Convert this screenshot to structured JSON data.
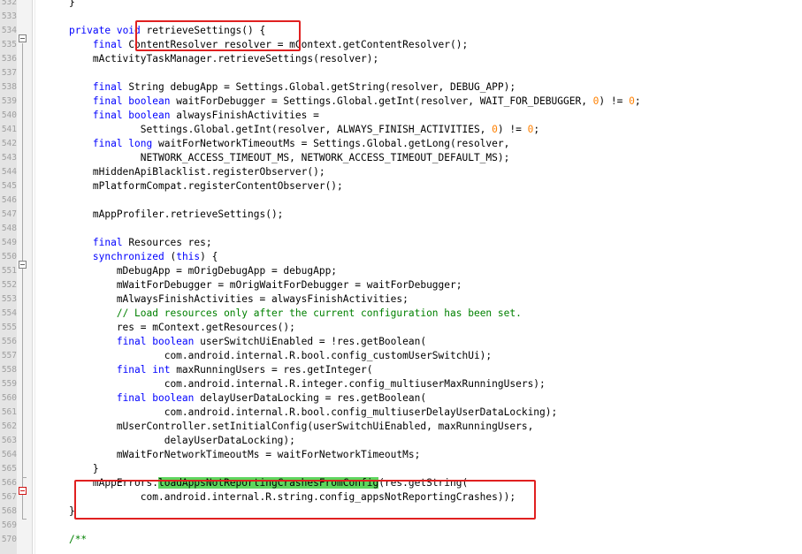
{
  "editor": {
    "lines": [
      {
        "n": "532",
        "t": [
          {
            "s": "    }"
          }
        ]
      },
      {
        "n": "533",
        "t": [
          {
            "s": ""
          }
        ]
      },
      {
        "n": "534",
        "t": [
          {
            "s": "    "
          },
          {
            "s": "private void",
            "c": "kw"
          },
          {
            "s": " retrieveSettings() {"
          }
        ]
      },
      {
        "n": "535",
        "t": [
          {
            "s": "        "
          },
          {
            "s": "final",
            "c": "kw"
          },
          {
            "s": " ContentResolver resolver = mContext.getContentResolver();"
          }
        ]
      },
      {
        "n": "536",
        "t": [
          {
            "s": "        mActivityTaskManager.retrieveSettings(resolver);"
          }
        ]
      },
      {
        "n": "537",
        "t": [
          {
            "s": ""
          }
        ]
      },
      {
        "n": "538",
        "t": [
          {
            "s": "        "
          },
          {
            "s": "final",
            "c": "kw"
          },
          {
            "s": " String debugApp = Settings.Global.getString(resolver, DEBUG_APP);"
          }
        ]
      },
      {
        "n": "539",
        "t": [
          {
            "s": "        "
          },
          {
            "s": "final boolean",
            "c": "kw"
          },
          {
            "s": " waitForDebugger = Settings.Global.getInt(resolver, WAIT_FOR_DEBUGGER, "
          },
          {
            "s": "0",
            "c": "num"
          },
          {
            "s": ") != "
          },
          {
            "s": "0",
            "c": "num"
          },
          {
            "s": ";"
          }
        ]
      },
      {
        "n": "540",
        "t": [
          {
            "s": "        "
          },
          {
            "s": "final boolean",
            "c": "kw"
          },
          {
            "s": " alwaysFinishActivities ="
          }
        ]
      },
      {
        "n": "541",
        "t": [
          {
            "s": "                Settings.Global.getInt(resolver, ALWAYS_FINISH_ACTIVITIES, "
          },
          {
            "s": "0",
            "c": "num"
          },
          {
            "s": ") != "
          },
          {
            "s": "0",
            "c": "num"
          },
          {
            "s": ";"
          }
        ]
      },
      {
        "n": "542",
        "t": [
          {
            "s": "        "
          },
          {
            "s": "final long",
            "c": "kw"
          },
          {
            "s": " waitForNetworkTimeoutMs = Settings.Global.getLong(resolver,"
          }
        ]
      },
      {
        "n": "543",
        "t": [
          {
            "s": "                NETWORK_ACCESS_TIMEOUT_MS, NETWORK_ACCESS_TIMEOUT_DEFAULT_MS);"
          }
        ]
      },
      {
        "n": "544",
        "t": [
          {
            "s": "        mHiddenApiBlacklist.registerObserver();"
          }
        ]
      },
      {
        "n": "545",
        "t": [
          {
            "s": "        mPlatformCompat.registerContentObserver();"
          }
        ]
      },
      {
        "n": "546",
        "t": [
          {
            "s": ""
          }
        ]
      },
      {
        "n": "547",
        "t": [
          {
            "s": "        mAppProfiler.retrieveSettings();"
          }
        ]
      },
      {
        "n": "548",
        "t": [
          {
            "s": ""
          }
        ]
      },
      {
        "n": "549",
        "t": [
          {
            "s": "        "
          },
          {
            "s": "final",
            "c": "kw"
          },
          {
            "s": " Resources res;"
          }
        ]
      },
      {
        "n": "550",
        "t": [
          {
            "s": "        "
          },
          {
            "s": "synchronized",
            "c": "kw"
          },
          {
            "s": " ("
          },
          {
            "s": "this",
            "c": "kw"
          },
          {
            "s": ") {"
          }
        ]
      },
      {
        "n": "551",
        "t": [
          {
            "s": "            mDebugApp = mOrigDebugApp = debugApp;"
          }
        ]
      },
      {
        "n": "552",
        "t": [
          {
            "s": "            mWaitForDebugger = mOrigWaitForDebugger = waitForDebugger;"
          }
        ]
      },
      {
        "n": "553",
        "t": [
          {
            "s": "            mAlwaysFinishActivities = alwaysFinishActivities;"
          }
        ]
      },
      {
        "n": "554",
        "t": [
          {
            "s": "            "
          },
          {
            "s": "// Load resources only after the current configuration has been set.",
            "c": "cm"
          }
        ]
      },
      {
        "n": "555",
        "t": [
          {
            "s": "            res = mContext.getResources();"
          }
        ]
      },
      {
        "n": "556",
        "t": [
          {
            "s": "            "
          },
          {
            "s": "final boolean",
            "c": "kw"
          },
          {
            "s": " userSwitchUiEnabled = !res.getBoolean("
          }
        ]
      },
      {
        "n": "557",
        "t": [
          {
            "s": "                    com.android.internal.R.bool.config_customUserSwitchUi);"
          }
        ]
      },
      {
        "n": "558",
        "t": [
          {
            "s": "            "
          },
          {
            "s": "final int",
            "c": "kw"
          },
          {
            "s": " maxRunningUsers = res.getInteger("
          }
        ]
      },
      {
        "n": "559",
        "t": [
          {
            "s": "                    com.android.internal.R.integer.config_multiuserMaxRunningUsers);"
          }
        ]
      },
      {
        "n": "560",
        "t": [
          {
            "s": "            "
          },
          {
            "s": "final boolean",
            "c": "kw"
          },
          {
            "s": " delayUserDataLocking = res.getBoolean("
          }
        ]
      },
      {
        "n": "561",
        "t": [
          {
            "s": "                    com.android.internal.R.bool.config_multiuserDelayUserDataLocking);"
          }
        ]
      },
      {
        "n": "562",
        "t": [
          {
            "s": "            mUserController.setInitialConfig(userSwitchUiEnabled, maxRunningUsers,"
          }
        ]
      },
      {
        "n": "563",
        "t": [
          {
            "s": "                    delayUserDataLocking);"
          }
        ]
      },
      {
        "n": "564",
        "t": [
          {
            "s": "            mWaitForNetworkTimeoutMs = waitForNetworkTimeoutMs;"
          }
        ]
      },
      {
        "n": "565",
        "t": [
          {
            "s": "        }"
          }
        ]
      },
      {
        "n": "566",
        "t": [
          {
            "s": "        mAppErrors."
          },
          {
            "s": "loadAppsNotReportingCrashesFromConfig",
            "c": "hl"
          },
          {
            "s": "(res.getString("
          }
        ]
      },
      {
        "n": "567",
        "t": [
          {
            "s": "                com.android.internal.R.string.config_appsNotReportingCrashes));"
          }
        ]
      },
      {
        "n": "568",
        "t": [
          {
            "s": "    }"
          }
        ]
      },
      {
        "n": "569",
        "t": [
          {
            "s": ""
          }
        ]
      },
      {
        "n": "570",
        "t": [
          {
            "s": "    "
          },
          {
            "s": "/**",
            "c": "cm"
          }
        ]
      }
    ],
    "fold_markers": [
      "534",
      "550",
      "566"
    ],
    "colors": {
      "keyword": "#0000ff",
      "number": "#ff8000",
      "comment": "#008000",
      "highlight": "#5ed55e",
      "annotation": "#e02020"
    }
  }
}
